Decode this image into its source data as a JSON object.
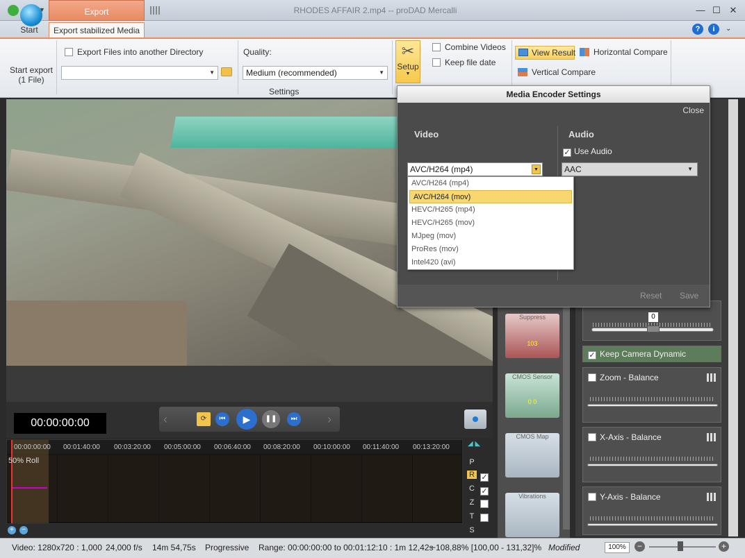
{
  "titlebar": {
    "export_tab": "Export",
    "window_title": "RHODES AFFAIR 2.mp4  --  proDAD Mercalli",
    "min": "—",
    "max": "☐",
    "close": "✕"
  },
  "tabs": {
    "start": "Start",
    "export": "Export stabilized Media"
  },
  "ribbon": {
    "start_export_label": "Start export",
    "start_export_sub": "(1 File)",
    "export_dir_label": "Export Files into another Directory",
    "export_dir_value": "",
    "quality_label": "Quality:",
    "quality_value": "Medium    (recommended)",
    "settings_group": "Settings",
    "setup_label": "Setup",
    "combine_videos": "Combine Videos",
    "keep_file_date": "Keep file date",
    "view_result": "View Result",
    "horizontal_compare": "Horizontal Compare",
    "vertical_compare": "Vertical Compare"
  },
  "encoder": {
    "title": "Media Encoder Settings",
    "close": "Close",
    "video_label": "Video",
    "audio_label": "Audio",
    "use_audio": "Use Audio",
    "video_codec": "AVC/H264 (mp4)",
    "audio_codec": "AAC",
    "codec_options": [
      "AVC/H264 (mp4)",
      "AVC/H264 (mov)",
      "HEVC/H265 (mp4)",
      "HEVC/H265 (mov)",
      "MJpeg (mov)",
      "ProRes (mov)",
      "Intel420 (avi)"
    ],
    "reset": "Reset",
    "save": "Save"
  },
  "filters": {
    "suppress": "Suppress",
    "suppress_val": "103",
    "cmos_sensor": "CMOS Sensor",
    "cmos_vals": "0   0",
    "cmos_map": "CMOS Map",
    "vibrations": "Vibrations"
  },
  "right_panel": {
    "slider_value": "0",
    "keep_camera_dynamic": "Keep Camera Dynamic",
    "zoom_balance": "Zoom - Balance",
    "x_balance": "X-Axis - Balance",
    "y_balance": "Y-Axis - Balance"
  },
  "transport": {
    "timecode": "00:00:00:00"
  },
  "timeline": {
    "ticks": [
      "00:00:00:00",
      "00:01:40:00",
      "00:03:20:00",
      "00:05:00:00",
      "00:06:40:00",
      "00:08:20:00",
      "00:10:00:00",
      "00:11:40:00",
      "00:13:20:00"
    ],
    "track_label": "50% Roll",
    "rows": [
      "P",
      "R",
      "C",
      "Z",
      "T",
      "S"
    ]
  },
  "status": {
    "video": "Video: 1280x720 : 1,000",
    "fps": "24,000 f/s",
    "duration": "14m 54,75s",
    "scan": "Progressive",
    "range": "Range: 00:00:00:00 to 00:01:12:10 : 1m 12,42s",
    "zoomrange": "~108,88% [100,00 - 131,32]%",
    "modified": "Modified",
    "zoom": "100%"
  }
}
